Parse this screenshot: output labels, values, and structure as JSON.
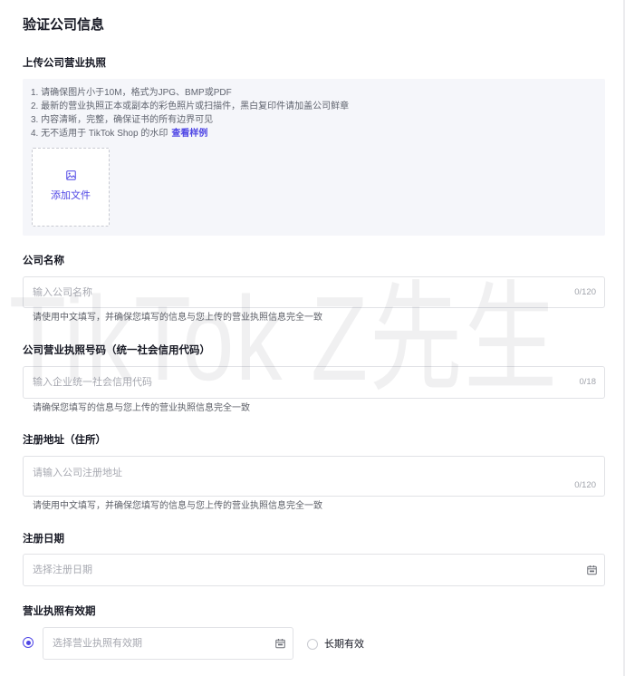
{
  "page": {
    "title": "验证公司信息"
  },
  "watermark": {
    "text": "TikTok Z先生"
  },
  "upload": {
    "label": "上传公司营业执照",
    "instructions": [
      "1. 请确保图片小于10M，格式为JPG、BMP或PDF",
      "2. 最新的营业执照正本或副本的彩色照片或扫描件，黑白复印件请加盖公司鲜章",
      "3. 内容清晰，完整，确保证书的所有边界可见",
      "4. 无不适用于 TikTok Shop 的水印"
    ],
    "sample_link": "查看样例",
    "add_file_button": {
      "label": "添加文件",
      "icon": "image-icon"
    }
  },
  "company_name": {
    "label": "公司名称",
    "placeholder": "输入公司名称",
    "value": "",
    "counter": "0/120",
    "helper": "请使用中文填写，并确保您填写的信息与您上传的营业执照信息完全一致"
  },
  "license_number": {
    "label": "公司营业执照号码（统一社会信用代码）",
    "placeholder": "输入企业统一社会信用代码",
    "value": "",
    "counter": "0/18",
    "helper": "请确保您填写的信息与您上传的营业执照信息完全一致"
  },
  "registered_address": {
    "label": "注册地址（住所）",
    "placeholder": "请输入公司注册地址",
    "value": "",
    "counter": "0/120",
    "helper": "请使用中文填写，并确保您填写的信息与您上传的营业执照信息完全一致"
  },
  "registration_date": {
    "label": "注册日期",
    "placeholder": "选择注册日期",
    "value": "",
    "icon": "calendar-icon"
  },
  "license_validity": {
    "label": "营业执照有效期",
    "date_option": {
      "selected": true,
      "placeholder": "选择营业执照有效期",
      "value": "",
      "icon": "calendar-icon"
    },
    "long_term_option": {
      "selected": false,
      "label": "长期有效"
    }
  },
  "colors": {
    "accent": "#4f46e5",
    "text": "#161823",
    "muted": "#5c5f67",
    "placeholder": "#a7a9b1",
    "border": "#e1e2e6",
    "panel": "#f5f6fa"
  }
}
